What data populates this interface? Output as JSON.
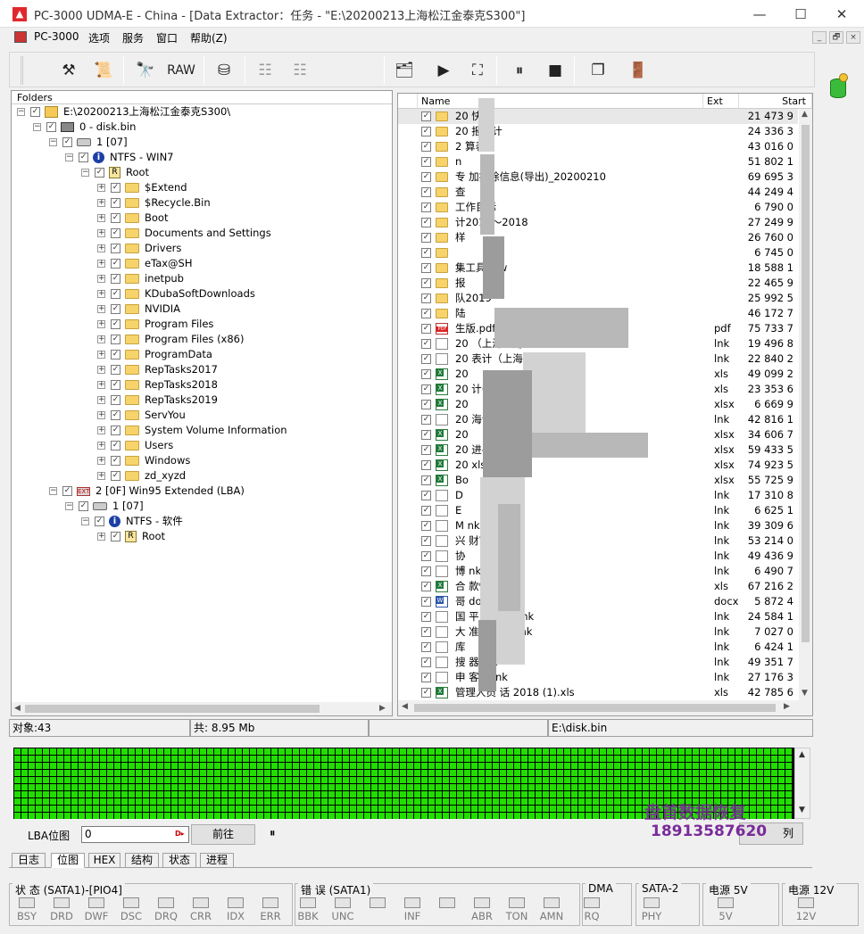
{
  "window": {
    "app_icon": "PC-3000 logo",
    "title": "PC-3000 UDMA-E - China - [Data Extractor：任务 - \"E:\\20200213上海松江金泰克S300\"]",
    "controls": [
      "minimize-icon",
      "maximize-icon",
      "close-icon"
    ]
  },
  "menu": {
    "items": [
      "PC-3000",
      "选项",
      "服务",
      "窗口",
      "帮助(Z)"
    ],
    "mdi_controls": [
      "_",
      "🗗",
      "×"
    ]
  },
  "toolbar": {
    "raw_label": "RAW",
    "icons": [
      "tools-icon",
      "scroll-icon",
      "binoculars-icon",
      "raw-button",
      "disk-export-icon",
      "tree-left-icon",
      "tree-right-icon",
      "folder-save-icon",
      "play-icon",
      "network-icon",
      "pause-icon",
      "stop-icon",
      "windows-icon",
      "exit-icon"
    ]
  },
  "tree": {
    "header": "Folders",
    "nodes": [
      {
        "label": "E:\\20200213上海松江金泰克S300\\",
        "icon": "host-icon",
        "exp": "−"
      },
      {
        "label": "0 - disk.bin",
        "icon": "diskfile-icon",
        "exp": "−"
      },
      {
        "label": "1 [07]",
        "icon": "disk-icon",
        "exp": "−"
      },
      {
        "label": "NTFS - WIN7",
        "icon": "info-icon",
        "exp": "−"
      },
      {
        "label": "Root",
        "icon": "root-icon",
        "exp": "−"
      },
      {
        "label": "$Extend",
        "icon": "folder-icon",
        "exp": "+"
      },
      {
        "label": "$Recycle.Bin",
        "icon": "folder-icon",
        "exp": "+"
      },
      {
        "label": "Boot",
        "icon": "folder-icon",
        "exp": "+"
      },
      {
        "label": "Documents and Settings",
        "icon": "folder-icon",
        "exp": "+"
      },
      {
        "label": "Drivers",
        "icon": "folder-icon",
        "exp": "+"
      },
      {
        "label": "eTax@SH",
        "icon": "folder-icon",
        "exp": "+"
      },
      {
        "label": "inetpub",
        "icon": "folder-icon",
        "exp": "+"
      },
      {
        "label": "KDubaSoftDownloads",
        "icon": "folder-icon",
        "exp": "+"
      },
      {
        "label": "NVIDIA",
        "icon": "folder-icon",
        "exp": "+"
      },
      {
        "label": "Program Files",
        "icon": "folder-icon",
        "exp": "+"
      },
      {
        "label": "Program Files (x86)",
        "icon": "folder-icon",
        "exp": "+"
      },
      {
        "label": "ProgramData",
        "icon": "folder-icon",
        "exp": "+"
      },
      {
        "label": "RepTasks2017",
        "icon": "folder-icon",
        "exp": "+"
      },
      {
        "label": "RepTasks2018",
        "icon": "folder-icon",
        "exp": "+"
      },
      {
        "label": "RepTasks2019",
        "icon": "folder-icon",
        "exp": "+"
      },
      {
        "label": "ServYou",
        "icon": "folder-icon",
        "exp": "+"
      },
      {
        "label": "System Volume Information",
        "icon": "folder-icon",
        "exp": "+"
      },
      {
        "label": "Users",
        "icon": "folder-icon",
        "exp": "+"
      },
      {
        "label": "Windows",
        "icon": "folder-icon",
        "exp": "+"
      },
      {
        "label": "zd_xyzd",
        "icon": "folder-icon",
        "exp": "+"
      },
      {
        "label": "2 [0F] Win95 Extended  (LBA)",
        "icon": "extended-partition-icon",
        "exp": "−"
      },
      {
        "label": "1 [07]",
        "icon": "disk-icon",
        "exp": "−"
      },
      {
        "label": "NTFS - 软件",
        "icon": "info-icon",
        "exp": "−"
      },
      {
        "label": "Root",
        "icon": "root-icon",
        "exp": "+"
      }
    ]
  },
  "list": {
    "columns": {
      "name": "Name",
      "ext": "Ext",
      "start": "Start"
    },
    "rows": [
      {
        "name": "20  快报",
        "ext": "",
        "start": "21 473 9",
        "icon": "folder"
      },
      {
        "name": "20  报审计",
        "ext": "",
        "start": "24 336 3",
        "icon": "folder"
      },
      {
        "name": "2  算表",
        "ext": "",
        "start": "43 016 0",
        "icon": "folder"
      },
      {
        "name": "n",
        "ext": "",
        "start": "51 802 1",
        "icon": "folder"
      },
      {
        "name": "专  加扣除信息(导出)_20200210",
        "ext": "",
        "start": "69 695 3",
        "icon": "folder"
      },
      {
        "name": "  查",
        "ext": "",
        "start": "44 249 4",
        "icon": "folder"
      },
      {
        "name": "  工作目标",
        "ext": "",
        "start": "6 790 0",
        "icon": "folder"
      },
      {
        "name": "  计2017～2018",
        "ext": "",
        "start": "27 249 9",
        "icon": "folder"
      },
      {
        "name": "  样",
        "ext": "",
        "start": "26 760 0",
        "icon": "folder"
      },
      {
        "name": "",
        "ext": "",
        "start": "6 745 0",
        "icon": "folder"
      },
      {
        "name": "  集工具new",
        "ext": "",
        "start": "18 588 1",
        "icon": "folder"
      },
      {
        "name": "  报",
        "ext": "",
        "start": "22 465 9",
        "icon": "folder"
      },
      {
        "name": "  队2019",
        "ext": "",
        "start": "25 992 5",
        "icon": "folder"
      },
      {
        "name": "陆",
        "ext": "",
        "start": "46 172 7",
        "icon": "folder"
      },
      {
        "name": "  生版.pdf",
        "ext": "pdf",
        "start": "75 733 7",
        "icon": "pdf"
      },
      {
        "name": "20  （上海专用）",
        "ext": "lnk",
        "start": "19 496 8",
        "icon": "lnk"
      },
      {
        "name": "20  表计（上海专用）…",
        "ext": "lnk",
        "start": "22 840 2",
        "icon": "lnk"
      },
      {
        "name": "20",
        "ext": "xls",
        "start": "49 099 2",
        "icon": "xls"
      },
      {
        "name": "20  计(1).xls",
        "ext": "xls",
        "start": "23 353 6",
        "icon": "xls"
      },
      {
        "name": "20",
        "ext": "xlsx",
        "start": "6 669 9",
        "icon": "xls"
      },
      {
        "name": "20  海专用）",
        "ext": "lnk",
        "start": "42 816 1",
        "icon": "lnk"
      },
      {
        "name": "20",
        "ext": "xlsx",
        "start": "34 606 7",
        "icon": "xls"
      },
      {
        "name": "20  进-离职…",
        "ext": "xlsx",
        "start": "59 433 5",
        "icon": "xls"
      },
      {
        "name": "20  xls",
        "ext": "xlsx",
        "start": "74 923 5",
        "icon": "xls"
      },
      {
        "name": "Bo",
        "ext": "xlsx",
        "start": "55 725 9",
        "icon": "xls"
      },
      {
        "name": "D",
        "ext": "lnk",
        "start": "17 310 8",
        "icon": "lnk"
      },
      {
        "name": "E",
        "ext": "lnk",
        "start": "6 625 1",
        "icon": "lnk"
      },
      {
        "name": "M  nk",
        "ext": "lnk",
        "start": "39 309 6",
        "icon": "lnk"
      },
      {
        "name": "兴  财富版.lnk",
        "ext": "lnk",
        "start": "53 214 0",
        "icon": "lnk"
      },
      {
        "name": "协",
        "ext": "lnk",
        "start": "49 436 9",
        "icon": "lnk"
      },
      {
        "name": "博  nk",
        "ext": "lnk",
        "start": "6 490 7",
        "icon": "lnk"
      },
      {
        "name": "合  款情况.xls",
        "ext": "xls",
        "start": "67 216 2",
        "icon": "xls"
      },
      {
        "name": "哥  docx",
        "ext": "docx",
        "start": "5 872 4",
        "icon": "doc"
      },
      {
        "name": "国  平台2019.lnk",
        "ext": "lnk",
        "start": "24 584 1",
        "icon": "lnk"
      },
      {
        "name": "大  准版网络).lnk",
        "ext": "lnk",
        "start": "7 027 0",
        "icon": "lnk"
      },
      {
        "name": "库",
        "ext": "lnk",
        "start": "6 424 1",
        "icon": "lnk"
      },
      {
        "name": "搜  器.lnk",
        "ext": "lnk",
        "start": "49 351 7",
        "icon": "lnk"
      },
      {
        "name": "申  客端.lnk",
        "ext": "lnk",
        "start": "27 176 3",
        "icon": "lnk"
      },
      {
        "name": "管理人员  话 2018 (1).xls",
        "ext": "xls",
        "start": "42 785 6",
        "icon": "xls"
      }
    ]
  },
  "status": {
    "objects": "对象:43",
    "total": "共:  8.95 Mb",
    "path": "E:\\disk.bin"
  },
  "lba": {
    "label": "LBA位图",
    "value": "0",
    "go_button": "前往",
    "pause": "⏸",
    "watermark_name": "盘首数据恢复",
    "watermark_phone": "18913587620",
    "cut_button_tail": "列"
  },
  "tabs": [
    "日志",
    "位图",
    "HEX",
    "结构",
    "状态",
    "进程"
  ],
  "tabs_active": "位图",
  "leds": {
    "status_title": "状 态 (SATA1)-[PIO4]",
    "status": [
      "BSY",
      "DRD",
      "DWF",
      "DSC",
      "DRQ",
      "CRR",
      "IDX",
      "ERR"
    ],
    "error_title": "错 误 (SATA1)",
    "error": [
      "BBK",
      "UNC",
      "",
      "INF",
      "",
      "ABR",
      "TON",
      "AMN"
    ],
    "dma_title": "DMA",
    "dma": [
      "RQ"
    ],
    "sata_title": "SATA-2",
    "sata": [
      "PHY"
    ],
    "p5_title": "电源 5V",
    "p5": [
      "5V"
    ],
    "p12_title": "电源 12V",
    "p12": [
      "12V"
    ]
  },
  "colors": {
    "map_green": "#22dd00",
    "watermark": "#7a2b9a",
    "map_bg": "#000000"
  }
}
